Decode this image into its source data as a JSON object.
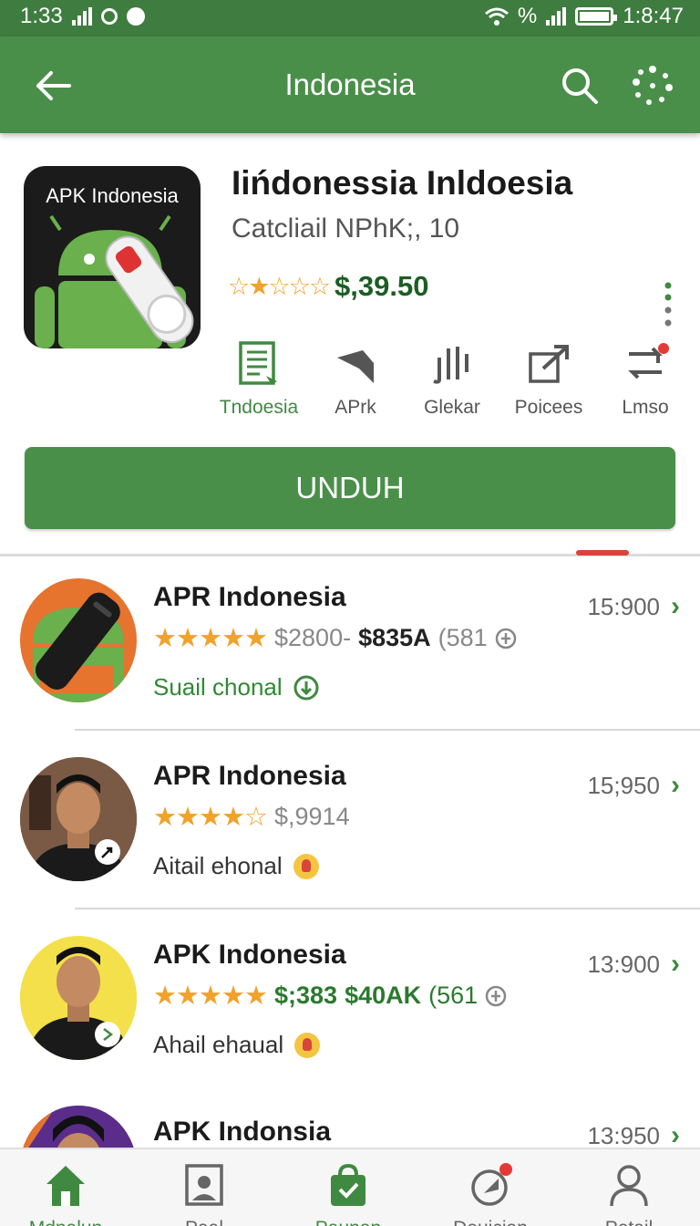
{
  "status_bar": {
    "time_left": "1:33",
    "time_right": "1:8:47",
    "battery_text": "%"
  },
  "app_bar": {
    "title": "Indonesia"
  },
  "app": {
    "icon_text": "APK Indonesia",
    "name": "Iińdonessia Inldoesia",
    "subtitle": "Catcliail NPhK;, 10",
    "stars": "☆★☆☆☆",
    "price": "$,39.50"
  },
  "actions": [
    {
      "label": "Tndoesia",
      "icon": "document-icon"
    },
    {
      "label": "APrk",
      "icon": "flag-icon"
    },
    {
      "label": "Glekar",
      "icon": "equalizer-icon"
    },
    {
      "label": "Poicees",
      "icon": "share-icon"
    },
    {
      "label": "Lmso",
      "icon": "transfer-icon"
    }
  ],
  "download_label": "UNDUH",
  "list": [
    {
      "title": "APR Indonesia",
      "stars": "★★★★★",
      "price_a": "$2800-",
      "price_b": "$835A",
      "count": "(581",
      "sub": "Suail chonal",
      "time": "15:900"
    },
    {
      "title": "APR Indonesia",
      "stars": "★★★★☆",
      "price_a": "$,9914",
      "sub": "Aitail ehonal",
      "time": "15;950"
    },
    {
      "title": "APK Indonesia",
      "stars": "★★★★★",
      "price_a": "$;383",
      "price_b": "$40AK",
      "count": "(561",
      "sub": "Ahail ehaual",
      "time": "13:900"
    },
    {
      "title": "APK Indonsia",
      "time": "13:950"
    }
  ],
  "bottom_nav": [
    {
      "label": "Mdnalun",
      "icon": "home-icon"
    },
    {
      "label": "Paal",
      "icon": "contact-icon"
    },
    {
      "label": "Paunan",
      "icon": "shopping-bag-icon"
    },
    {
      "label": "Deuician",
      "icon": "tag-icon"
    },
    {
      "label": "Petail",
      "icon": "profile-icon"
    }
  ],
  "colors": {
    "brand": "#4a8f49",
    "star": "#f1a22a",
    "accent_red": "#d9453a"
  }
}
